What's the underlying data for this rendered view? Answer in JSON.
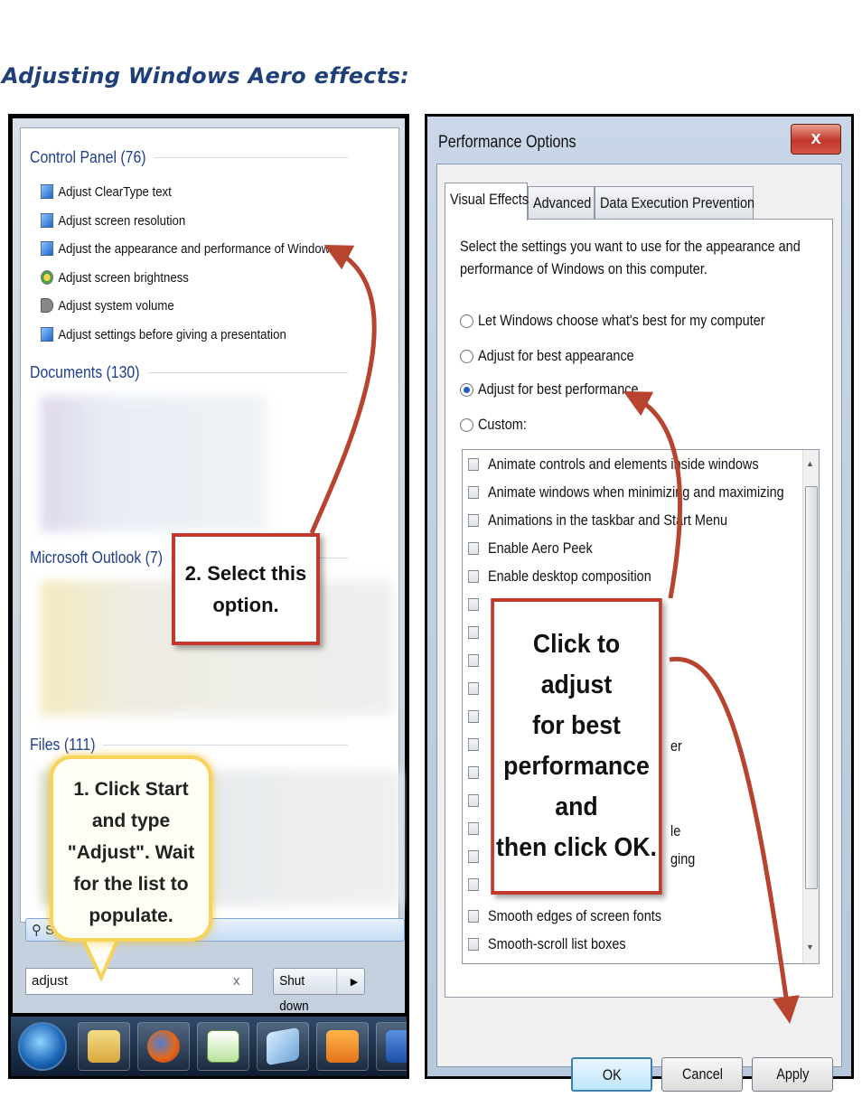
{
  "document": {
    "title": "Adjusting Windows Aero effects:"
  },
  "start_menu": {
    "groups": [
      {
        "label": "Control Panel (76)"
      },
      {
        "label": "Documents (130)"
      },
      {
        "label": "Microsoft Outlook (7)"
      },
      {
        "label": "Files (111)"
      }
    ],
    "control_panel_items": [
      "Adjust ClearType text",
      "Adjust screen resolution",
      "Adjust the appearance and performance of Windows",
      "Adjust screen brightness",
      "Adjust system volume",
      "Adjust settings before giving a presentation"
    ],
    "search_more_label": "Se",
    "search_value": "adjust",
    "search_clear": "x",
    "shutdown_label": "Shut down",
    "shutdown_arrow": "▶",
    "taskbar_icons": [
      "start-orb",
      "explorer-icon",
      "firefox-icon",
      "notepad-icon",
      "notes-icon",
      "outlook-icon",
      "word-icon"
    ]
  },
  "perf_dialog": {
    "title": "Performance Options",
    "close_label": "x",
    "tabs": [
      "Visual Effects",
      "Advanced",
      "Data Execution Prevention"
    ],
    "description_line1": "Select the settings you want to use for the appearance and",
    "description_line2": "performance of Windows on this computer.",
    "options": [
      {
        "label": "Let Windows choose what's best for my computer",
        "selected": false
      },
      {
        "label": "Adjust for best appearance",
        "selected": false
      },
      {
        "label": "Adjust for best performance",
        "selected": true
      },
      {
        "label": "Custom:",
        "selected": false
      }
    ],
    "effects_top": [
      "Animate controls and elements inside windows",
      "Animate windows when minimizing and maximizing",
      "Animations in the taskbar and Start Menu",
      "Enable Aero Peek",
      "Enable desktop composition"
    ],
    "effects_partial": [
      "er",
      "le",
      "ging"
    ],
    "effects_bottom": [
      "Smooth edges of screen fonts",
      "Smooth-scroll list boxes"
    ],
    "buttons": {
      "ok": "OK",
      "cancel": "Cancel",
      "apply": "Apply"
    }
  },
  "callouts": {
    "step1": [
      "1. Click Start",
      "and type",
      "\"Adjust\". Wait",
      "for the list to",
      "populate."
    ],
    "step2": [
      "2. Select this",
      "option."
    ],
    "perf": [
      "Click to adjust",
      "for best",
      "performance and",
      "then  click OK."
    ]
  },
  "colors": {
    "title_blue": "#1f3f7a",
    "callout_red": "#c0392b",
    "callout_yellow": "#f7d35c",
    "arrow_red": "#b8442f"
  }
}
